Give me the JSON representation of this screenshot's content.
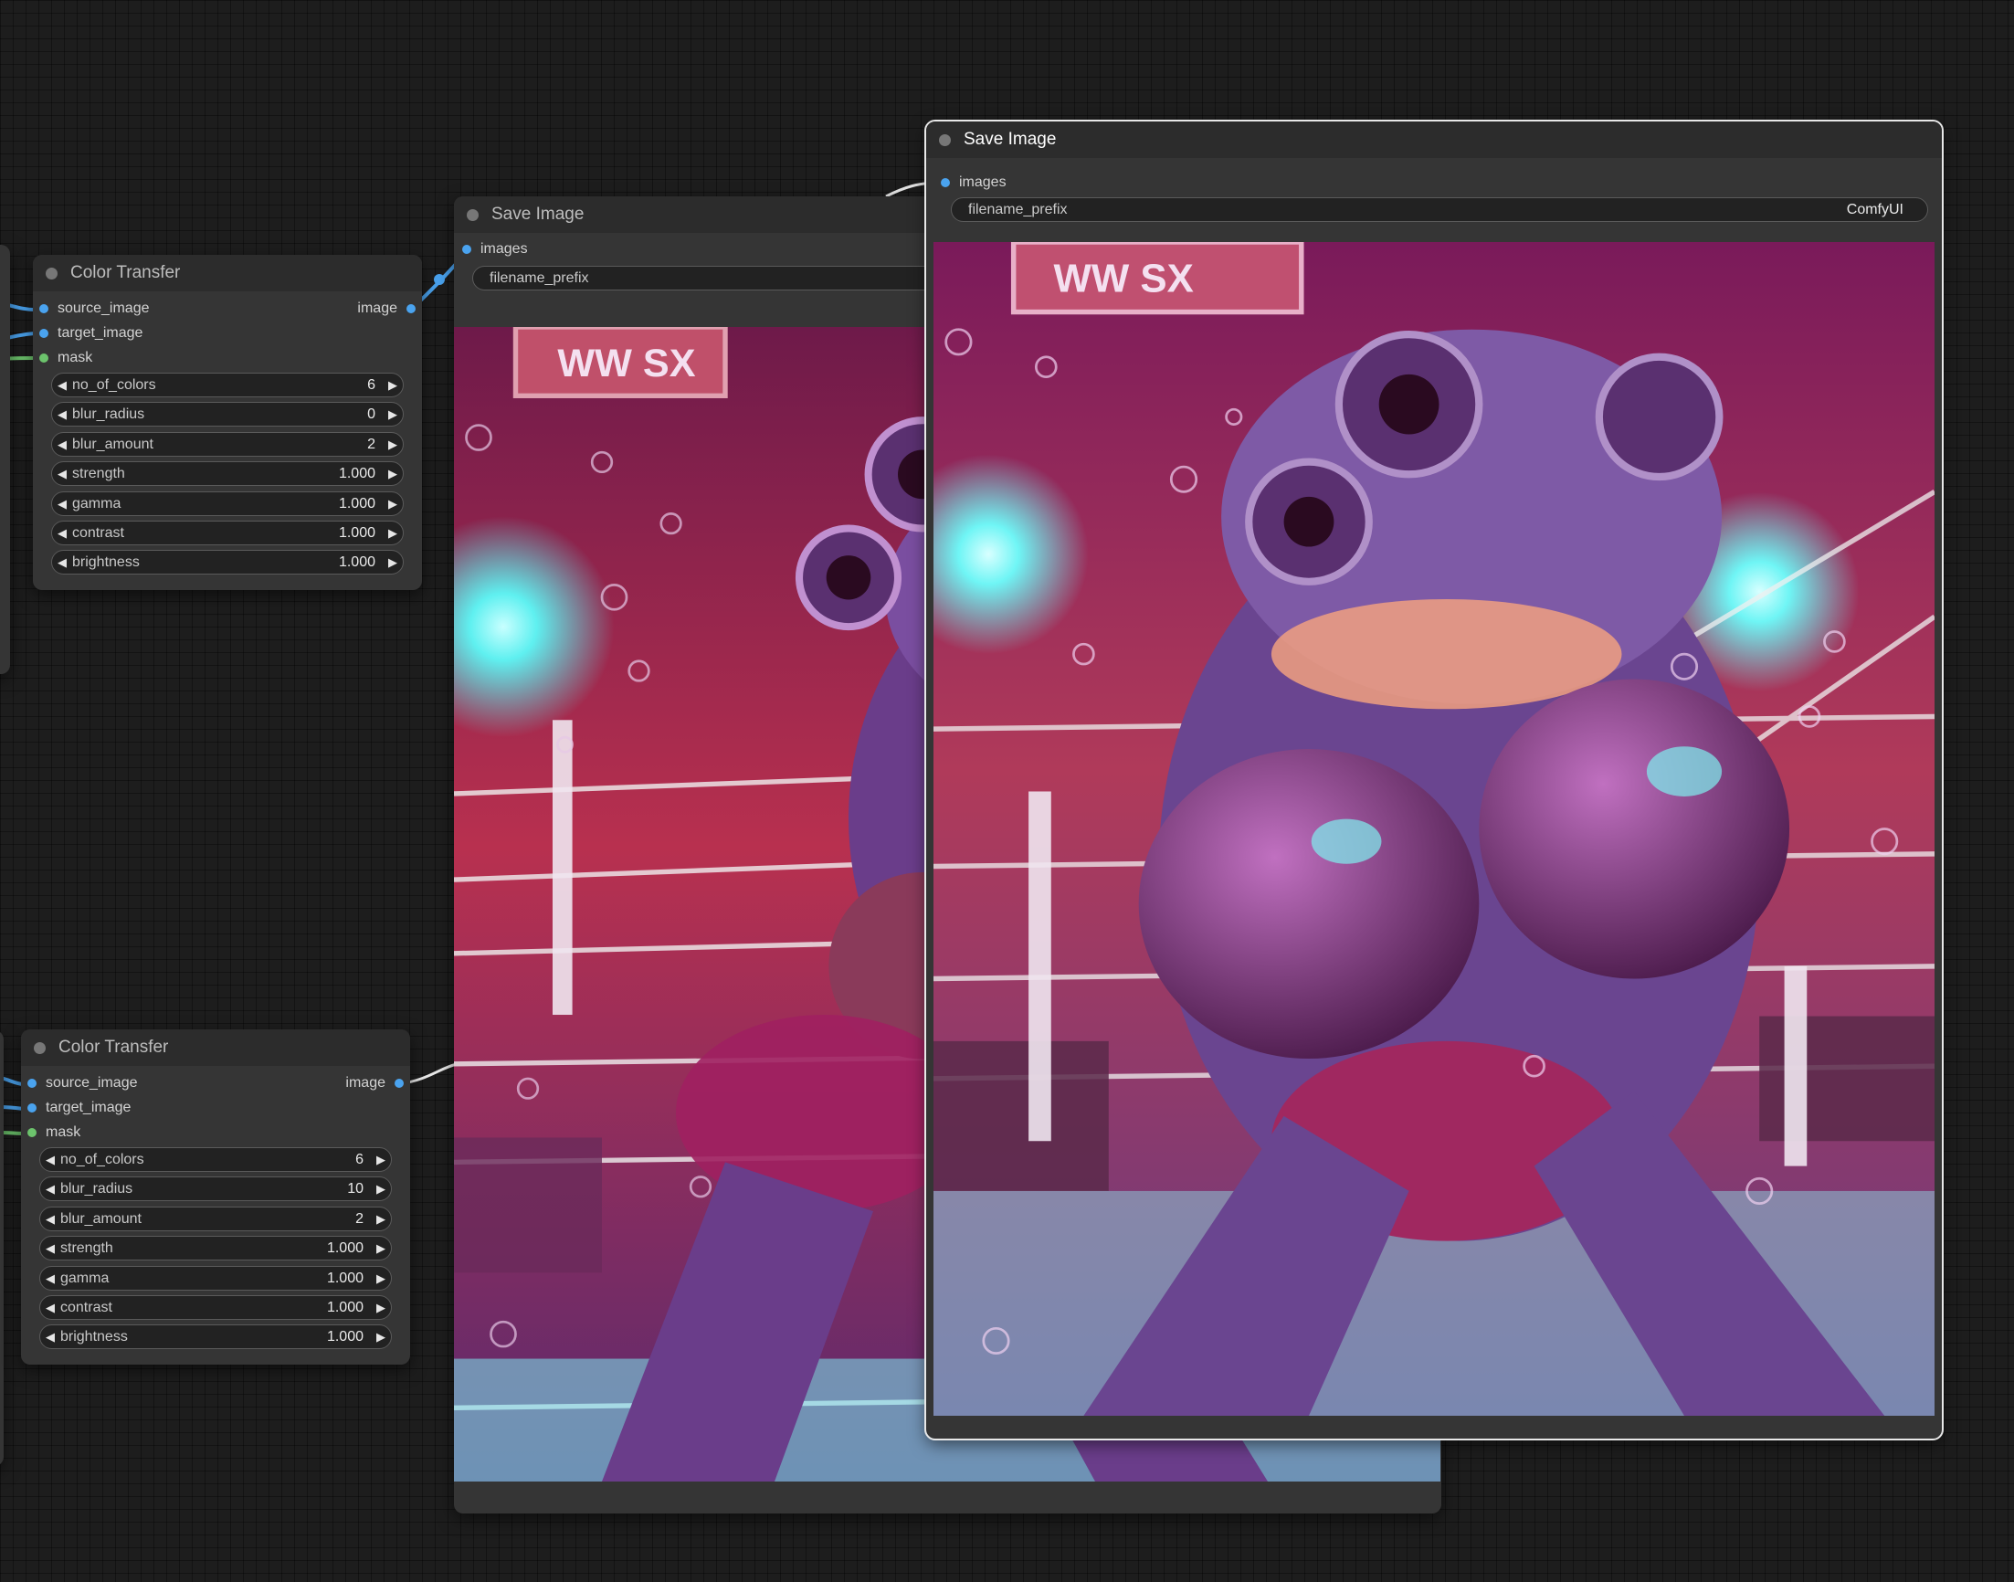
{
  "nodes": {
    "color_transfer_1": {
      "title": "Color Transfer",
      "inputs": [
        "source_image",
        "target_image",
        "mask"
      ],
      "output": "image",
      "widgets": [
        {
          "label": "no_of_colors",
          "value": "6"
        },
        {
          "label": "blur_radius",
          "value": "0"
        },
        {
          "label": "blur_amount",
          "value": "2"
        },
        {
          "label": "strength",
          "value": "1.000"
        },
        {
          "label": "gamma",
          "value": "1.000"
        },
        {
          "label": "contrast",
          "value": "1.000"
        },
        {
          "label": "brightness",
          "value": "1.000"
        }
      ]
    },
    "color_transfer_2": {
      "title": "Color Transfer",
      "inputs": [
        "source_image",
        "target_image",
        "mask"
      ],
      "output": "image",
      "widgets": [
        {
          "label": "no_of_colors",
          "value": "6"
        },
        {
          "label": "blur_radius",
          "value": "10"
        },
        {
          "label": "blur_amount",
          "value": "2"
        },
        {
          "label": "strength",
          "value": "1.000"
        },
        {
          "label": "gamma",
          "value": "1.000"
        },
        {
          "label": "contrast",
          "value": "1.000"
        },
        {
          "label": "brightness",
          "value": "1.000"
        }
      ]
    },
    "save_image_1": {
      "title": "Save Image",
      "input": "images",
      "filename_label": "filename_prefix",
      "filename_value": ""
    },
    "save_image_2": {
      "title": "Save Image",
      "input": "images",
      "filename_label": "filename_prefix",
      "filename_value": "ComfyUI"
    }
  },
  "preview_banner_text": "WW SX",
  "colors": {
    "canvas": "#1d1d1d",
    "node_body": "#353535",
    "node_title": "#2c2c2c",
    "image_slot": "#4aa3ef",
    "mask_slot": "#6cc36c",
    "selected_outline": "#e8e8e8"
  },
  "icons": {
    "decrement": "left-triangle",
    "increment": "right-triangle"
  }
}
